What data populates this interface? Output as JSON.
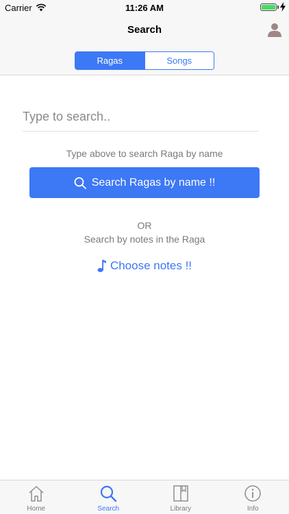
{
  "status_bar": {
    "carrier": "Carrier",
    "time": "11:26 AM",
    "battery_level": 1.0
  },
  "nav": {
    "title": "Search",
    "profile_icon": "person-icon"
  },
  "segments": [
    {
      "label": "Ragas",
      "active": true
    },
    {
      "label": "Songs",
      "active": false
    }
  ],
  "search": {
    "placeholder": "Type to search..",
    "value": "",
    "hint": "Type above to search Raga by name",
    "button_label": "Search Ragas by name !!"
  },
  "notes": {
    "or_label": "OR",
    "hint": "Search by notes in the Raga",
    "button_label": "Choose notes !!"
  },
  "tabs": [
    {
      "label": "Home",
      "icon": "home-icon",
      "active": false
    },
    {
      "label": "Search",
      "icon": "search-icon",
      "active": true
    },
    {
      "label": "Library",
      "icon": "book-icon",
      "active": false
    },
    {
      "label": "Info",
      "icon": "info-icon",
      "active": false
    }
  ],
  "colors": {
    "accent": "#3d78f5",
    "inactive": "#7a7a7a",
    "battery": "#4cd964"
  }
}
